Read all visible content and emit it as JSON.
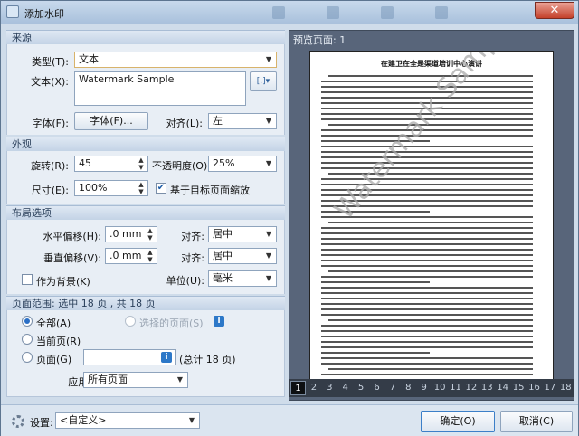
{
  "window": {
    "title": "添加水印",
    "close_symbol": "✕"
  },
  "source": {
    "header": "来源",
    "type_label": "类型(T):",
    "type_value": "文本",
    "text_label": "文本(X):",
    "text_value": "Watermark Sample",
    "font_label": "字体(F):",
    "font_button": "字体(F)...",
    "align_label": "对齐(L):",
    "align_value": "左"
  },
  "appearance": {
    "header": "外观",
    "rotation_label": "旋转(R):",
    "rotation_value": "45",
    "opacity_label": "不透明度(O):",
    "opacity_value": "25%",
    "size_label": "尺寸(E):",
    "size_value": "100%",
    "scale_label": "基于目标页面缩放",
    "scale_checked": true
  },
  "layout": {
    "header": "布局选项",
    "h_offset_label": "水平偏移(H):",
    "h_offset_value": ".0 mm",
    "v_offset_label": "垂直偏移(V):",
    "v_offset_value": ".0 mm",
    "h_align_label": "对齐:",
    "h_align_value": "居中",
    "v_align_label": "对齐:",
    "v_align_value": "居中",
    "bg_label": "作为背景(K)",
    "bg_checked": false,
    "unit_label": "单位(U):",
    "unit_value": "毫米"
  },
  "page_range": {
    "header": "页面范围: 选中 18 页 , 共 18 页",
    "all_label": "全部(A)",
    "selected_label": "选择的页面(S)",
    "current_label": "当前页(R)",
    "pages_label": "页面(G)",
    "pages_value": "",
    "total_label": "(总计 18 页)",
    "apply_label": "应用到:",
    "apply_value": "所有页面"
  },
  "preview": {
    "label": "预览页面: 1",
    "doc_title": "在建卫在全是渠道培训中心演讲",
    "watermark_text": "Watermark Sample",
    "pages": [
      "1",
      "2",
      "3",
      "4",
      "5",
      "6",
      "7",
      "8",
      "9",
      "10",
      "11",
      "12",
      "13",
      "14",
      "15",
      "16",
      "17",
      "18"
    ],
    "current_page": "1"
  },
  "footer": {
    "settings_label": "设置:",
    "settings_value": "<自定义>",
    "ok_button": "确定(O)",
    "cancel_button": "取消(C)"
  }
}
